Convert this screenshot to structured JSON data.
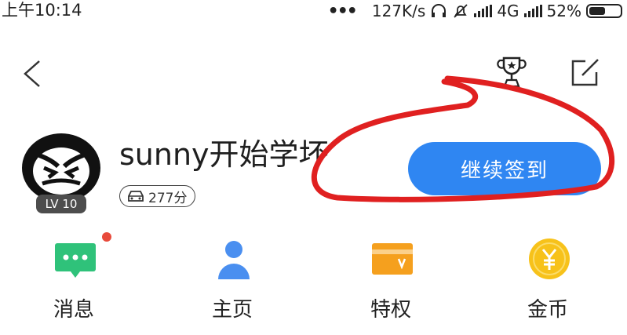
{
  "status_bar": {
    "time": "上午10:14",
    "more": "•••",
    "net_speed": "127K/s",
    "network": "4G",
    "battery": "52%",
    "battery_level": 0.52
  },
  "profile": {
    "username": "sunny开始学坏",
    "level": "LV 10",
    "score": "277分",
    "checkin_label": "继续签到"
  },
  "features": [
    {
      "label": "消息",
      "icon": "message-icon",
      "has_badge": true
    },
    {
      "label": "主页",
      "icon": "person-icon"
    },
    {
      "label": "特权",
      "icon": "vip-card-icon"
    },
    {
      "label": "金币",
      "icon": "coin-icon"
    }
  ],
  "colors": {
    "accent": "#2f86f2",
    "message": "#2fc27a",
    "person": "#4a8ff0",
    "vip": "#f5a01e",
    "coin": "#f7c21a",
    "badge": "#e84a3b",
    "annotation": "#e02020"
  }
}
